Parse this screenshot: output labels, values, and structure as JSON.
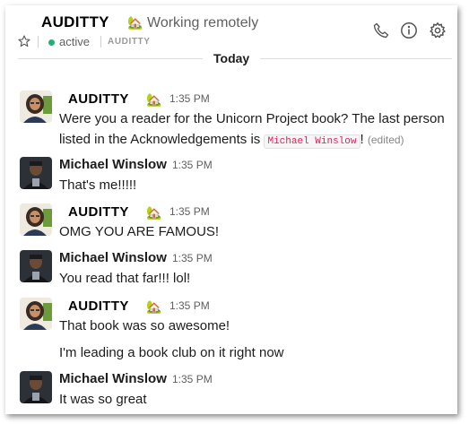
{
  "header": {
    "title": "AUDITTY",
    "status_emoji": "🏡",
    "status_text": "Working remotely",
    "presence": "active",
    "small_title": "AUDITTY"
  },
  "divider": {
    "label": "Today"
  },
  "messages": [
    {
      "author": "AUDITTY",
      "emoji": "🏡",
      "time": "1:35 PM",
      "line1": "Were you a reader for the Unicorn Project book? The last person",
      "line2_pre": "listed in the Acknowledgements is",
      "code": "Michael Winslow",
      "line2_post": "!",
      "edited": "(edited)"
    },
    {
      "author": "Michael Winslow",
      "time": "1:35 PM",
      "text": "That's me!!!!!"
    },
    {
      "author": "AUDITTY",
      "emoji": "🏡",
      "time": "1:35 PM",
      "text": "OMG YOU ARE FAMOUS!"
    },
    {
      "author": "Michael Winslow",
      "time": "1:35 PM",
      "text": "You read that far!!! lol!"
    },
    {
      "author": "AUDITTY",
      "emoji": "🏡",
      "time": "1:35 PM",
      "text": "That book was so awesome!",
      "text2": "I'm leading a book club on it right now"
    },
    {
      "author": "Michael Winslow",
      "time": "1:35 PM",
      "text": "It was so great"
    }
  ],
  "colors": {
    "presence_green": "#2bac76",
    "code_text": "#e01e5a",
    "muted": "#616061"
  },
  "icons": [
    "star-icon",
    "phone-icon",
    "info-icon",
    "gear-icon",
    "house-emoji-icon"
  ]
}
